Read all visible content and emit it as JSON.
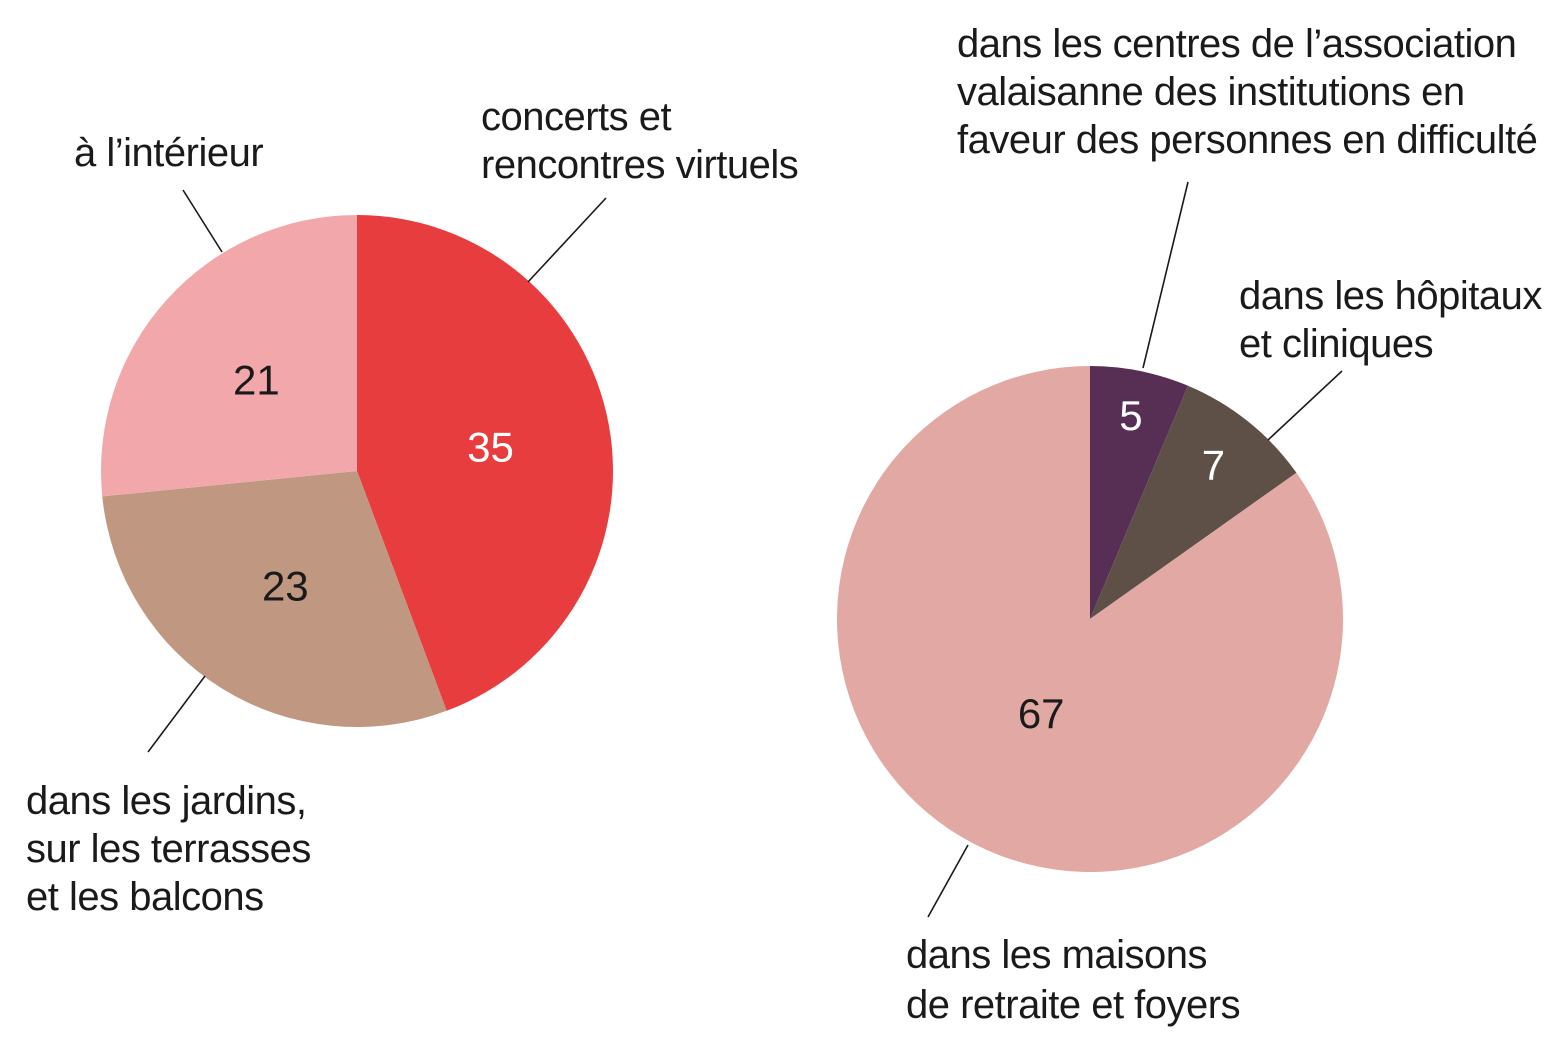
{
  "chart_data": [
    {
      "type": "pie",
      "slices": [
        {
          "label_lines": [
            "concerts et",
            "rencontres virtuels"
          ],
          "value": 35,
          "color": "#e83d3f",
          "value_text_color": "#ffffff"
        },
        {
          "label_lines": [
            "dans les jardins,",
            "sur les terrasses",
            "et les balcons"
          ],
          "value": 23,
          "color": "#c09882",
          "value_text_color": "#1a1a1a"
        },
        {
          "label_lines": [
            "à l’intérieur"
          ],
          "value": 21,
          "color": "#f2a7aa",
          "value_text_color": "#1a1a1a"
        }
      ]
    },
    {
      "type": "pie",
      "slices": [
        {
          "label_lines": [
            "dans les centres de l’association",
            "valaisanne des institutions en",
            "faveur des personnes en difficulté"
          ],
          "value": 5,
          "color": "#582f54",
          "value_text_color": "#ffffff"
        },
        {
          "label_lines": [
            "dans les hôpitaux",
            "et cliniques"
          ],
          "value": 7,
          "color": "#5f5047",
          "value_text_color": "#ffffff"
        },
        {
          "label_lines": [
            "dans les maisons",
            "de retraite et foyers"
          ],
          "value": 67,
          "color": "#e2a8a4",
          "value_text_color": "#1a1a1a"
        }
      ]
    }
  ]
}
